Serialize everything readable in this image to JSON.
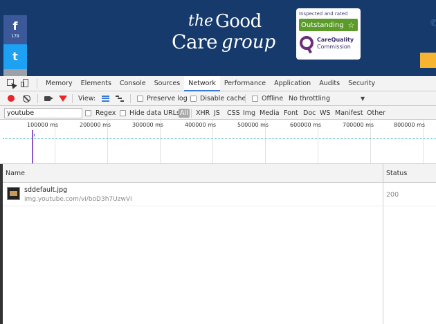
{
  "site": {
    "social": {
      "facebook_glyph": "f",
      "facebook_count": "179",
      "twitter_glyph": "t"
    },
    "logo": {
      "the": "the",
      "good": "Good",
      "care": "Care",
      "group": "group"
    },
    "cqc": {
      "inspected": "Inspected and rated",
      "rating": "Outstanding",
      "star": "☆",
      "name_line1": "CareQuality",
      "name_line2": "Commission"
    },
    "colors": {
      "header_bg": "#163a6b",
      "cqc_green": "#5a9b2a",
      "cqc_purple": "#6d2d7d",
      "cta_yellow": "#f7b431"
    }
  },
  "devtools": {
    "tabs": [
      "Memory",
      "Elements",
      "Console",
      "Sources",
      "Network",
      "Performance",
      "Application",
      "Audits",
      "Security"
    ],
    "active_tab": "Network",
    "toolbar": {
      "view_label": "View:",
      "preserve_log": "Preserve log",
      "disable_cache": "Disable cache",
      "offline": "Offline",
      "throttling": "No throttling"
    },
    "filter": {
      "value": "youtube",
      "regex": "Regex",
      "hide_data_urls": "Hide data URLs",
      "types": [
        "All",
        "XHR",
        "JS",
        "CSS",
        "Img",
        "Media",
        "Font",
        "Doc",
        "WS",
        "Manifest",
        "Other"
      ]
    },
    "overview": {
      "ticks": [
        "100000 ms",
        "200000 ms",
        "300000 ms",
        "400000 ms",
        "500000 ms",
        "600000 ms",
        "700000 ms",
        "800000 ms"
      ]
    },
    "table": {
      "headers": {
        "name": "Name",
        "status": "Status"
      },
      "rows": [
        {
          "name": "sddefault.jpg",
          "url": "img.youtube.com/vi/boD3h7UzwVI",
          "status": "200"
        }
      ]
    },
    "colors": {
      "accent": "#3879d9",
      "record_red": "#e8262b",
      "timeline_teal": "#2aa1a1"
    }
  }
}
